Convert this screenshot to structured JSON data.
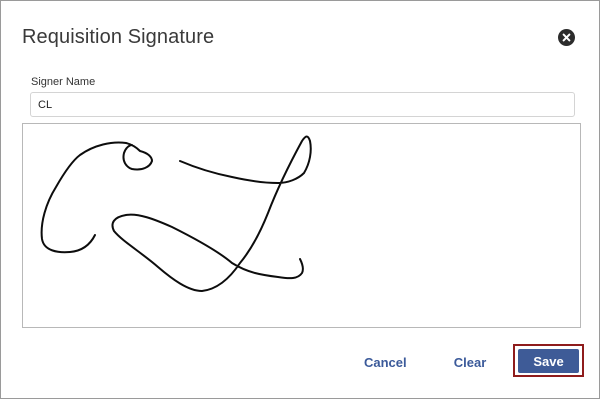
{
  "dialog": {
    "title": "Requisition Signature"
  },
  "form": {
    "signer_label": "Signer Name",
    "signer_value": "CL",
    "signer_placeholder": ""
  },
  "actions": {
    "cancel_label": "Cancel",
    "clear_label": "Clear",
    "save_label": "Save"
  },
  "icons": {
    "close": "close-icon"
  },
  "colors": {
    "accent": "#3e5b97",
    "link": "#3b5a9a",
    "focus_outline": "#8f1c1c"
  }
}
